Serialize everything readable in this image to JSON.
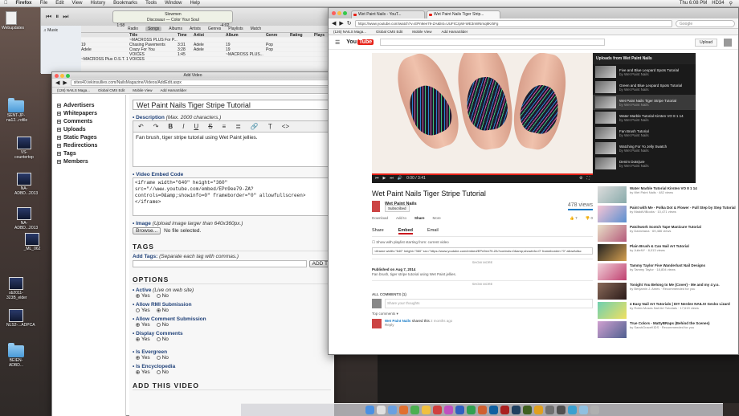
{
  "menubar": {
    "app": "Firefox",
    "menus": [
      "File",
      "Edit",
      "View",
      "History",
      "Bookmarks",
      "Tools",
      "Window",
      "Help"
    ],
    "clock": "Thu 6:08 PM",
    "user": "HD34"
  },
  "desktop": {
    "icons": [
      "Webupdates",
      "SENT-JP-na12...rofile",
      "VS-countertop",
      "NA-ADBD...2013",
      "NA-ADBD...2013",
      "_ML_062",
      "sb2011-323B_elder",
      "NLS2-...ADPCA",
      "BEIEN-ADBD..."
    ]
  },
  "itunes": {
    "now_playing": {
      "title": "Slowmen",
      "artist": "Discosaur — Color Your Soul",
      "elapsed": "1:58",
      "remaining": "-4:02"
    },
    "nav": [
      "Radio",
      "Songs",
      "Albums",
      "Artists",
      "Genres",
      "Playlists",
      "Match"
    ],
    "sidebar_label": "Music",
    "columns": [
      "",
      "Title",
      "Time",
      "Artist",
      "Album",
      "Genre",
      "Rating",
      "Plays"
    ],
    "rows": [
      [
        "",
        "~MACROSS PLUS For P...",
        "",
        "",
        "",
        "",
        "",
        ""
      ],
      [
        "19",
        "Chasing Pavements",
        "3:31",
        "Adele",
        "19",
        "Pop",
        "",
        ""
      ],
      [
        "Adele",
        "Crazy For You",
        "3:28",
        "Adele",
        "19",
        "Pop",
        "",
        ""
      ],
      [
        "",
        "VOICES",
        "1:45",
        "",
        "~MACROSS PLUS...",
        "",
        "",
        ""
      ],
      [
        "~MACROSS Plus O.S.T. 1",
        "VOICES",
        "",
        "",
        "",
        "",
        "",
        ""
      ]
    ]
  },
  "addvideo": {
    "window_title": "Add Video",
    "url": "sites40.tekinsullies.com/NailsMagazine/Videos/AddEdit.aspx",
    "bookmarks": [
      "(126) NAILS Maga...",
      "Global CMS Edit",
      "Mobile View",
      "Add HamaSlider"
    ],
    "nav": [
      "Advertisers",
      "Whitepapers",
      "Comments",
      "Uploads",
      "Static Pages",
      "Redirections",
      "Tags",
      "Members"
    ],
    "title_value": "Wet Paint Nails Tiger Stripe Tutorial",
    "description_label": "Description",
    "description_hint": "(Max. 2000 characters.)",
    "description_value": "Fan brush, tiger stripe tutorial using Wet Paint jellies.",
    "embed_label": "Video Embed Code",
    "embed_value": "<iframe width=\"640\" height=\"360\" src=\"//www.youtube.com/embed/EPn9ee79-ZA?controls=0&amp;showinfo=0\" frameborder=\"0\" allowfullscreen></iframe>",
    "image_label": "Image",
    "image_hint": "(Upload image larger than 640x360px.)",
    "browse_label": "Browse...",
    "no_file": "No file selected.",
    "tags_section": "TAGS",
    "add_tags_label": "Add Tags:",
    "add_tags_hint": "(Separate each tag with commas.)",
    "add_button": "ADD T",
    "options_section": "OPTIONS",
    "options": [
      {
        "label": "Active",
        "hint": "(Live on web site)",
        "selected": "Yes"
      },
      {
        "label": "Allow RMI Submission",
        "hint": "",
        "selected": "No"
      },
      {
        "label": "Allow Comment Submission",
        "hint": "",
        "selected": "Yes"
      },
      {
        "label": "Display Comments",
        "hint": "",
        "selected": "Yes"
      },
      {
        "label": "Is Evergreen",
        "hint": "",
        "selected": "Yes"
      },
      {
        "label": "Is Encyclopedia",
        "hint": "",
        "selected": "Yes"
      }
    ],
    "yes": "Yes",
    "no": "No",
    "bottom_section": "ADD THIS VIDEO"
  },
  "chrome": {
    "tabs": [
      "Wet Paint Nails - YouT...",
      "Wet Paint Nails Tiger Strip..."
    ],
    "url": "https://www.youtube.com/watch?v=EPn9ee79-ZA&list=UUFICzpW-WE3nWNmq8Kr5Fg",
    "search_placeholder": "Google",
    "bookmarks": [
      "(126) NAILS Maga...",
      "Global CMS Edit",
      "Mobile View",
      "Add HamaSlider"
    ]
  },
  "youtube": {
    "upload": "Upload",
    "time": "0:00 / 3:41",
    "playlist_title": "Uploads from Wet Paint Nails",
    "playlist": [
      {
        "title": "Five and Blue Leopard Spots Tutorial",
        "by": "by Wet Paint Nails"
      },
      {
        "title": "Green and Blue Leopard Spots Tutorial",
        "by": "by Wet Paint Nails"
      },
      {
        "title": "Wet Paint Nails Tiger Stripe Tutorial",
        "by": "by Wet Paint Nails"
      },
      {
        "title": "Water Marble Tutorial Kirsten VO 8 1 14",
        "by": "by Wet Paint Nails"
      },
      {
        "title": "Fan Brush Tutorial",
        "by": "by Wet Paint Nails"
      },
      {
        "title": "Watching For Yo Jelly Swatch",
        "by": "by Wet Paint Nails"
      },
      {
        "title": "Denim Dots(ure",
        "by": "by Wet Paint Nails"
      }
    ],
    "video_title": "Wet Paint Nails Tiger Stripe Tutorial",
    "channel": "Wet Paint Nails",
    "subscribed": "Subscribed",
    "views": "478 views",
    "likes": "7",
    "dislikes": "0",
    "actions": [
      "Download",
      "Add to",
      "Share",
      "More"
    ],
    "share_tabs": [
      "Share",
      "Embed",
      "Email"
    ],
    "start_at": "Show with playlist starting from: current video",
    "embed_code": "<iframe width=\"640\" height=\"360\" src=\"https://www.youtube.com/embed/EPn9ee79-ZA?controls=0&amp;showinfo=0\" frameborder=\"0\" allowfullsc",
    "show_more": "SHOW MORE",
    "published": "Published on Aug 7, 2014",
    "description": "Fan brush, tiger stripe tutorial using Wet Paint jellies.",
    "comments_header": "ALL COMMENTS (1)",
    "comment_placeholder": "Share your thoughts",
    "sort": "Top comments",
    "comment_author": "Wet Paint Nails",
    "comment_text": "shared this",
    "comment_time": "2 months ago",
    "reply": "Reply",
    "related": [
      {
        "title": "Water Marble Tutorial Kirsten VO 8 1 14",
        "meta": "by Wet Paint Nails · 482 views"
      },
      {
        "title": "Paint with Me - Polka Dot & Flower - Full Step by Step Tutorial",
        "meta": "by MaddiViBooks · 10,471 views"
      },
      {
        "title": "Patchwork Scotch Tape Manicure Tutorial",
        "meta": "by Danichana · 69,486 views"
      },
      {
        "title": "Plain Brush & Can Nail Art Tutorial",
        "meta": "by JulieNY · 8,013 views"
      },
      {
        "title": "Tammy Taylor Five Wanderlust Nail Designs",
        "meta": "by Tammy Taylor · 18,804 views"
      },
      {
        "title": "Tonight You Belong to Me (Cover) - Me and my 4 y.o.",
        "meta": "by Benjamin J. Ames · Recommended for you"
      },
      {
        "title": "4 Easy Nail Art Tutorials | DIY Nerdee NAILS! Gecko Lizard",
        "meta": "by Robin Moses Nail Art Tutorials · 17,619 views"
      },
      {
        "title": "True Colors - MattyBRaps (Behind the Scenes)",
        "meta": "by SarahGraceKIDS · Recommended for you"
      }
    ]
  }
}
